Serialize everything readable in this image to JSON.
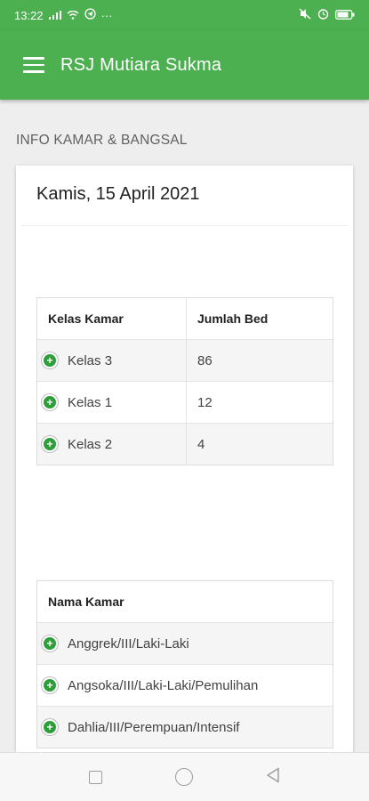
{
  "status_bar": {
    "time": "13:22",
    "signal": "ııl",
    "extra": "···"
  },
  "app_bar": {
    "title": "RSJ Mutiara Sukma"
  },
  "section_title": "INFO KAMAR & BANGSAL",
  "card": {
    "date": "Kamis, 15 April 2021",
    "kelas_table": {
      "headers": [
        "Kelas Kamar",
        "Jumlah Bed"
      ],
      "rows": [
        {
          "kelas": "Kelas 3",
          "jumlah": "86"
        },
        {
          "kelas": "Kelas 1",
          "jumlah": "12"
        },
        {
          "kelas": "Kelas 2",
          "jumlah": "4"
        }
      ]
    },
    "kamar_table": {
      "header": "Nama Kamar",
      "rows": [
        "Anggrek/III/Laki-Laki",
        "Angsoka/III/Laki-Laki/Pemulihan",
        "Dahlia/III/Perempuan/Intensif"
      ]
    }
  },
  "icons": {
    "menu": "hamburger-icon",
    "expand": "plus-circle-icon",
    "nav": [
      "recent-apps-icon",
      "home-icon",
      "back-icon"
    ]
  },
  "colors": {
    "primary": "#4caf50",
    "expand_button": "#2e9e3a"
  }
}
